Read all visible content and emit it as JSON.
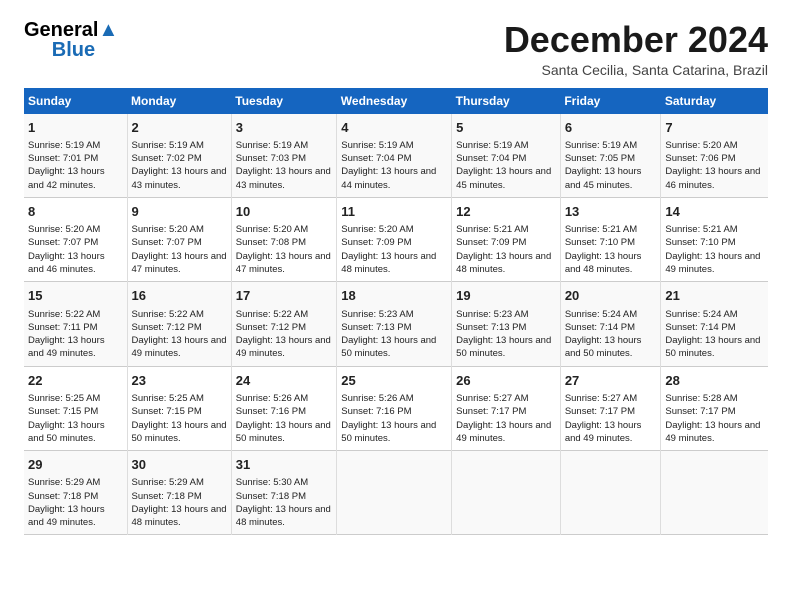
{
  "header": {
    "logo_general": "General",
    "logo_blue": "Blue",
    "title": "December 2024",
    "subtitle": "Santa Cecilia, Santa Catarina, Brazil"
  },
  "days_of_week": [
    "Sunday",
    "Monday",
    "Tuesday",
    "Wednesday",
    "Thursday",
    "Friday",
    "Saturday"
  ],
  "weeks": [
    [
      {
        "day": "1",
        "sunrise": "Sunrise: 5:19 AM",
        "sunset": "Sunset: 7:01 PM",
        "daylight": "Daylight: 13 hours and 42 minutes."
      },
      {
        "day": "2",
        "sunrise": "Sunrise: 5:19 AM",
        "sunset": "Sunset: 7:02 PM",
        "daylight": "Daylight: 13 hours and 43 minutes."
      },
      {
        "day": "3",
        "sunrise": "Sunrise: 5:19 AM",
        "sunset": "Sunset: 7:03 PM",
        "daylight": "Daylight: 13 hours and 43 minutes."
      },
      {
        "day": "4",
        "sunrise": "Sunrise: 5:19 AM",
        "sunset": "Sunset: 7:04 PM",
        "daylight": "Daylight: 13 hours and 44 minutes."
      },
      {
        "day": "5",
        "sunrise": "Sunrise: 5:19 AM",
        "sunset": "Sunset: 7:04 PM",
        "daylight": "Daylight: 13 hours and 45 minutes."
      },
      {
        "day": "6",
        "sunrise": "Sunrise: 5:19 AM",
        "sunset": "Sunset: 7:05 PM",
        "daylight": "Daylight: 13 hours and 45 minutes."
      },
      {
        "day": "7",
        "sunrise": "Sunrise: 5:20 AM",
        "sunset": "Sunset: 7:06 PM",
        "daylight": "Daylight: 13 hours and 46 minutes."
      }
    ],
    [
      {
        "day": "8",
        "sunrise": "Sunrise: 5:20 AM",
        "sunset": "Sunset: 7:07 PM",
        "daylight": "Daylight: 13 hours and 46 minutes."
      },
      {
        "day": "9",
        "sunrise": "Sunrise: 5:20 AM",
        "sunset": "Sunset: 7:07 PM",
        "daylight": "Daylight: 13 hours and 47 minutes."
      },
      {
        "day": "10",
        "sunrise": "Sunrise: 5:20 AM",
        "sunset": "Sunset: 7:08 PM",
        "daylight": "Daylight: 13 hours and 47 minutes."
      },
      {
        "day": "11",
        "sunrise": "Sunrise: 5:20 AM",
        "sunset": "Sunset: 7:09 PM",
        "daylight": "Daylight: 13 hours and 48 minutes."
      },
      {
        "day": "12",
        "sunrise": "Sunrise: 5:21 AM",
        "sunset": "Sunset: 7:09 PM",
        "daylight": "Daylight: 13 hours and 48 minutes."
      },
      {
        "day": "13",
        "sunrise": "Sunrise: 5:21 AM",
        "sunset": "Sunset: 7:10 PM",
        "daylight": "Daylight: 13 hours and 48 minutes."
      },
      {
        "day": "14",
        "sunrise": "Sunrise: 5:21 AM",
        "sunset": "Sunset: 7:10 PM",
        "daylight": "Daylight: 13 hours and 49 minutes."
      }
    ],
    [
      {
        "day": "15",
        "sunrise": "Sunrise: 5:22 AM",
        "sunset": "Sunset: 7:11 PM",
        "daylight": "Daylight: 13 hours and 49 minutes."
      },
      {
        "day": "16",
        "sunrise": "Sunrise: 5:22 AM",
        "sunset": "Sunset: 7:12 PM",
        "daylight": "Daylight: 13 hours and 49 minutes."
      },
      {
        "day": "17",
        "sunrise": "Sunrise: 5:22 AM",
        "sunset": "Sunset: 7:12 PM",
        "daylight": "Daylight: 13 hours and 49 minutes."
      },
      {
        "day": "18",
        "sunrise": "Sunrise: 5:23 AM",
        "sunset": "Sunset: 7:13 PM",
        "daylight": "Daylight: 13 hours and 50 minutes."
      },
      {
        "day": "19",
        "sunrise": "Sunrise: 5:23 AM",
        "sunset": "Sunset: 7:13 PM",
        "daylight": "Daylight: 13 hours and 50 minutes."
      },
      {
        "day": "20",
        "sunrise": "Sunrise: 5:24 AM",
        "sunset": "Sunset: 7:14 PM",
        "daylight": "Daylight: 13 hours and 50 minutes."
      },
      {
        "day": "21",
        "sunrise": "Sunrise: 5:24 AM",
        "sunset": "Sunset: 7:14 PM",
        "daylight": "Daylight: 13 hours and 50 minutes."
      }
    ],
    [
      {
        "day": "22",
        "sunrise": "Sunrise: 5:25 AM",
        "sunset": "Sunset: 7:15 PM",
        "daylight": "Daylight: 13 hours and 50 minutes."
      },
      {
        "day": "23",
        "sunrise": "Sunrise: 5:25 AM",
        "sunset": "Sunset: 7:15 PM",
        "daylight": "Daylight: 13 hours and 50 minutes."
      },
      {
        "day": "24",
        "sunrise": "Sunrise: 5:26 AM",
        "sunset": "Sunset: 7:16 PM",
        "daylight": "Daylight: 13 hours and 50 minutes."
      },
      {
        "day": "25",
        "sunrise": "Sunrise: 5:26 AM",
        "sunset": "Sunset: 7:16 PM",
        "daylight": "Daylight: 13 hours and 50 minutes."
      },
      {
        "day": "26",
        "sunrise": "Sunrise: 5:27 AM",
        "sunset": "Sunset: 7:17 PM",
        "daylight": "Daylight: 13 hours and 49 minutes."
      },
      {
        "day": "27",
        "sunrise": "Sunrise: 5:27 AM",
        "sunset": "Sunset: 7:17 PM",
        "daylight": "Daylight: 13 hours and 49 minutes."
      },
      {
        "day": "28",
        "sunrise": "Sunrise: 5:28 AM",
        "sunset": "Sunset: 7:17 PM",
        "daylight": "Daylight: 13 hours and 49 minutes."
      }
    ],
    [
      {
        "day": "29",
        "sunrise": "Sunrise: 5:29 AM",
        "sunset": "Sunset: 7:18 PM",
        "daylight": "Daylight: 13 hours and 49 minutes."
      },
      {
        "day": "30",
        "sunrise": "Sunrise: 5:29 AM",
        "sunset": "Sunset: 7:18 PM",
        "daylight": "Daylight: 13 hours and 48 minutes."
      },
      {
        "day": "31",
        "sunrise": "Sunrise: 5:30 AM",
        "sunset": "Sunset: 7:18 PM",
        "daylight": "Daylight: 13 hours and 48 minutes."
      },
      null,
      null,
      null,
      null
    ]
  ]
}
